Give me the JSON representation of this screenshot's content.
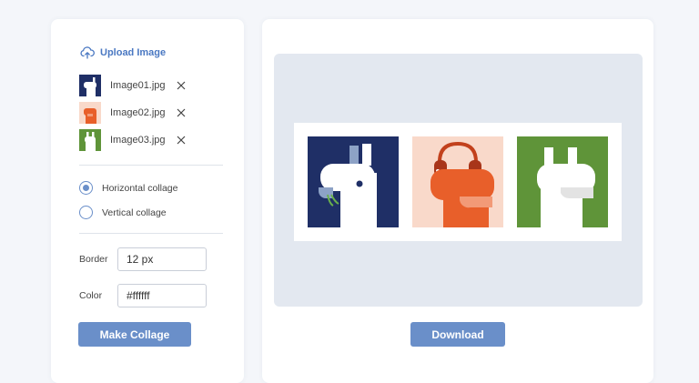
{
  "upload": {
    "label": "Upload Image",
    "icon": "cloud-upload-icon"
  },
  "files": [
    {
      "name": "Image01.jpg"
    },
    {
      "name": "Image02.jpg"
    },
    {
      "name": "Image03.jpg"
    }
  ],
  "layout_options": [
    {
      "label": "Horizontal collage",
      "checked": true
    },
    {
      "label": "Vertical collage",
      "checked": false
    }
  ],
  "border": {
    "label": "Border",
    "value": "12 px"
  },
  "color": {
    "label": "Color",
    "value": "#ffffff"
  },
  "buttons": {
    "make": "Make Collage",
    "download": "Download"
  },
  "colors": {
    "accent": "#6a8fc9",
    "link": "#4a78c2",
    "navy": "#1f2f66",
    "orange": "#e85f2a",
    "peach": "#f9d9ca",
    "green": "#5f9439",
    "preview_bg": "#e3e8f0"
  }
}
